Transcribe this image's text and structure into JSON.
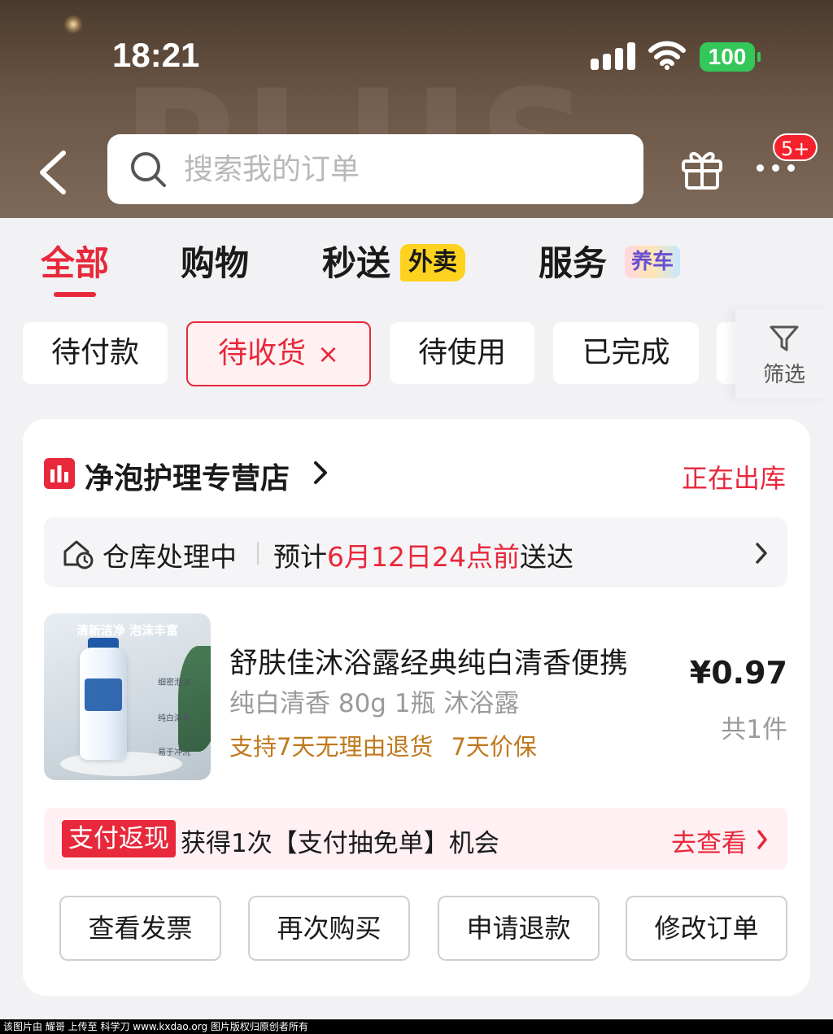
{
  "status_bar": {
    "time": "18:21",
    "battery": "100"
  },
  "header": {
    "bg_word": "PLUS",
    "search_placeholder": "搜索我的订单",
    "more_badge": "5+"
  },
  "tabs": [
    {
      "label": "全部",
      "active": true
    },
    {
      "label": "购物"
    },
    {
      "label": "秒送",
      "tag": "外卖"
    },
    {
      "label": "服务",
      "tag": "养车"
    }
  ],
  "chips": [
    {
      "label": "待付款"
    },
    {
      "label": "待收货",
      "active": true,
      "clear": "×"
    },
    {
      "label": "待使用"
    },
    {
      "label": "已完成"
    }
  ],
  "filter": {
    "label": "筛选"
  },
  "order": {
    "store_name": "净泡护理专营店",
    "status": "正在出库",
    "logistics": {
      "status": "仓库处理中",
      "prefix": "预计",
      "eta": "6月12日24点前",
      "suffix": "送达"
    },
    "product": {
      "image_title": "清新洁净  泡沫丰富",
      "image_features": [
        "细密泡沫",
        "纯白清香",
        "易于冲洗"
      ],
      "title": "舒肤佳沐浴露经典纯白清香便携",
      "spec": "纯白清香 80g 1瓶 沐浴露",
      "services": [
        "支持7天无理由退货",
        "7天价保"
      ],
      "price": "¥0.97",
      "quantity": "共1件"
    },
    "promo": {
      "tag": "支付返现",
      "message": "获得1次【支付抽免单】机会",
      "link": "去查看"
    },
    "actions": [
      "查看发票",
      "再次购买",
      "申请退款",
      "修改订单"
    ]
  },
  "footer_watermark": "该图片由 耀哥 上传至 科学刀 www.kxdao.org 图片版权归原创者所有",
  "colors": {
    "accent": "#e8283b",
    "service_orange": "#c0791c",
    "battery_green": "#34c759"
  }
}
